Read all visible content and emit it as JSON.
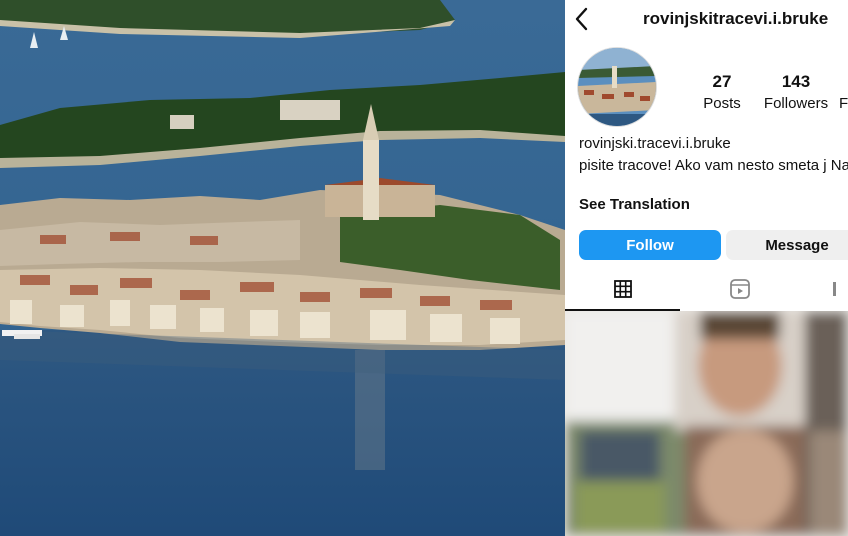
{
  "header": {
    "username": "rovinjskitracevi.i.bruke"
  },
  "stats": {
    "posts": {
      "value": "27",
      "label": "Posts"
    },
    "followers": {
      "value": "143",
      "label": "Followers"
    },
    "following": {
      "label": "Fo"
    }
  },
  "bio": {
    "name": "rovinjski.tracevi.i.bruke",
    "text": "pisite tracove! Ako vam nesto smeta j Nam.",
    "see_translation": "See Translation"
  },
  "actions": {
    "follow_label": "Follow",
    "message_label": "Message"
  },
  "tabs": [
    {
      "icon": "grid-icon",
      "active": true
    },
    {
      "icon": "reels-icon",
      "active": false
    },
    {
      "icon": "tagged-icon",
      "active": false
    }
  ],
  "colors": {
    "follow_button": "#1d97f2",
    "message_button": "#efefef",
    "sea": "#2a5a8a"
  }
}
